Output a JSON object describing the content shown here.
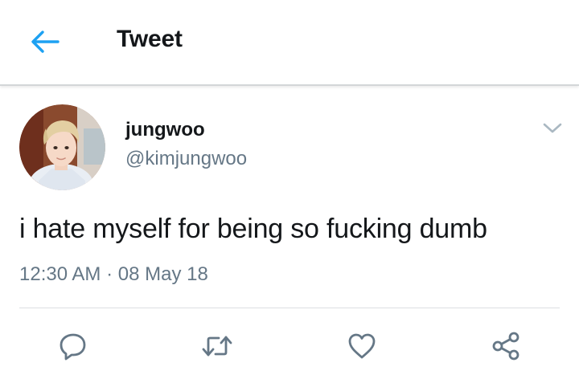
{
  "header": {
    "title": "Tweet",
    "back_icon": "arrow-left-icon",
    "accent_color": "#1da1f2"
  },
  "tweet": {
    "display_name": "jungwoo",
    "handle": "@kimjungwoo",
    "text": "i hate myself for being so fucking dumb",
    "time": "12:30 AM",
    "separator": "·",
    "date": "08 May 18",
    "menu_icon": "chevron-down-icon"
  },
  "actions": [
    {
      "icon": "reply-icon"
    },
    {
      "icon": "retweet-icon"
    },
    {
      "icon": "like-icon"
    },
    {
      "icon": "share-icon"
    }
  ],
  "colors": {
    "primary_text": "#14171a",
    "secondary_text": "#657786",
    "icon_gray": "#657786",
    "divider": "#dcdfe2"
  }
}
